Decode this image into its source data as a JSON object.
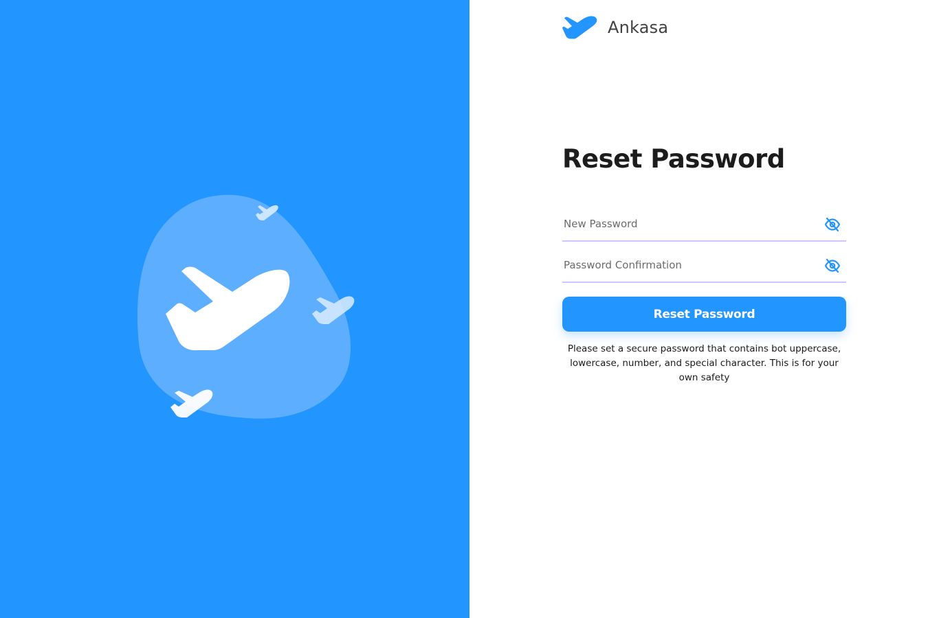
{
  "brand": {
    "name": "Ankasa",
    "logo_icon": "plane-logo-icon",
    "accent_color": "#2395FF"
  },
  "illustration": {
    "icon": "plane-takeoff-illustration",
    "background_color": "#2395FF",
    "blob_color": "#5DAEFF"
  },
  "form": {
    "title": "Reset Password",
    "new_password": {
      "placeholder": "New Password",
      "value": "",
      "toggle_icon": "eye-off-icon"
    },
    "password_confirmation": {
      "placeholder": "Password Confirmation",
      "value": "",
      "toggle_icon": "eye-off-icon"
    },
    "submit_label": "Reset Password",
    "hint": "Please set a secure password that contains bot uppercase, lowercase, number, and special character. This is for your own safety"
  }
}
